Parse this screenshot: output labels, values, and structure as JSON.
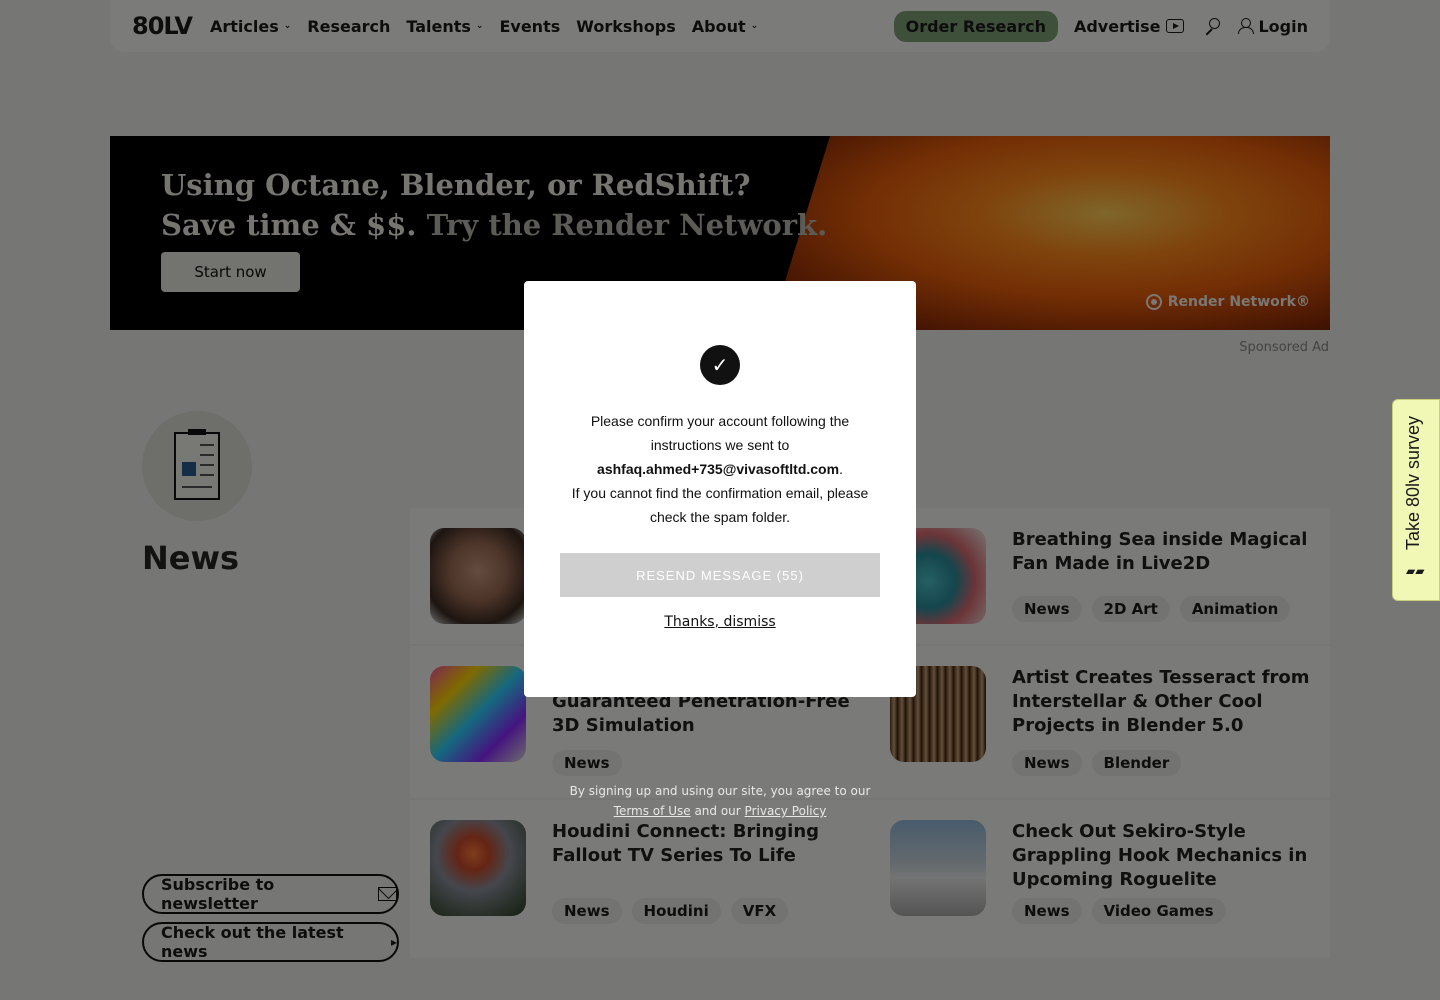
{
  "nav": {
    "logo": "80LV",
    "items": [
      {
        "label": "Articles",
        "has_dropdown": true
      },
      {
        "label": "Research",
        "has_dropdown": false
      },
      {
        "label": "Talents",
        "has_dropdown": true
      },
      {
        "label": "Events",
        "has_dropdown": false
      },
      {
        "label": "Workshops",
        "has_dropdown": false
      },
      {
        "label": "About",
        "has_dropdown": true
      }
    ],
    "order_research": "Order Research",
    "advertise": "Advertise",
    "login": "Login"
  },
  "ad": {
    "line1": "Using Octane, Blender, or RedShift?",
    "line2a": "Save time & $$.",
    "line2b": "Try the Render Network.",
    "button": "Start now",
    "brand": "Render Network®",
    "sponsored": "Sponsored Ad"
  },
  "section": {
    "title": "News",
    "subscribe": "Subscribe to newsletter",
    "latest": "Check out the latest news"
  },
  "articles": [
    {
      "title": "",
      "tags": [],
      "thumb": "portrait"
    },
    {
      "title": "Breathing Sea inside Magical Fan Made in Live2D",
      "tags": [
        "News",
        "2D Art",
        "Animation"
      ],
      "thumb": "fan"
    },
    {
      "title": "Guaranteed Penetration-Free 3D Simulation",
      "tags": [
        "News"
      ],
      "thumb": "cloth"
    },
    {
      "title": "Artist Creates Tesseract from Interstellar & Other Cool Projects in Blender 5.0",
      "tags": [
        "News",
        "Blender"
      ],
      "thumb": "tesseract"
    },
    {
      "title": "Houdini Connect: Bringing Fallout TV Series To Life",
      "tags": [
        "News",
        "Houdini",
        "VFX"
      ],
      "thumb": "explosion"
    },
    {
      "title": "Check Out Sekiro-Style Grappling Hook Mechanics in Upcoming Roguelite",
      "tags": [
        "News",
        "Video Games"
      ],
      "thumb": "game"
    }
  ],
  "modal": {
    "text1": "Please confirm your account following the instructions we sent to",
    "email": "ashfaq.ahmed+735@vivasoftltd.com",
    "text2": "If you cannot find the confirmation email, please check the spam folder.",
    "resend": "RESEND MESSAGE (55)",
    "dismiss": "Thanks, dismiss"
  },
  "legal": {
    "prefix": "By signing up and using our site, you agree to our",
    "terms": "Terms of Use",
    "and": "and our",
    "privacy": "Privacy Policy"
  },
  "survey": {
    "label": "Take 80lv survey"
  }
}
